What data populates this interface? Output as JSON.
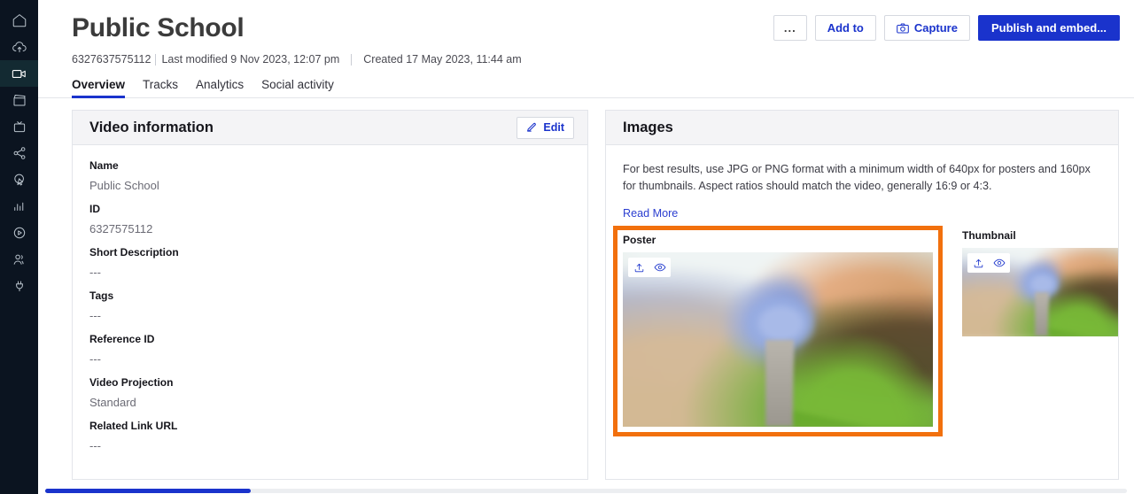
{
  "sidebar": {
    "items": [
      {
        "name": "home",
        "icon": "home-icon",
        "active": false
      },
      {
        "name": "upload",
        "icon": "cloud-upload-icon",
        "active": false
      },
      {
        "name": "video",
        "icon": "video-camera-icon",
        "active": true
      },
      {
        "name": "library",
        "icon": "clapperboard-icon",
        "active": false
      },
      {
        "name": "live",
        "icon": "tv-icon",
        "active": false
      },
      {
        "name": "social",
        "icon": "share-nodes-icon",
        "active": false
      },
      {
        "name": "interactivity",
        "icon": "cursor-target-icon",
        "active": false
      },
      {
        "name": "analytics",
        "icon": "bar-chart-icon",
        "active": false
      },
      {
        "name": "players",
        "icon": "play-circle-icon",
        "active": false
      },
      {
        "name": "audience",
        "icon": "users-icon",
        "active": false
      },
      {
        "name": "integrations",
        "icon": "plug-icon",
        "active": false
      }
    ]
  },
  "header": {
    "title": "Public School",
    "video_id": "6327637575112",
    "last_modified": "Last modified 9 Nov 2023, 12:07 pm",
    "created": "Created 17 May 2023, 11:44 am"
  },
  "actions": {
    "more_label": "...",
    "add_to_label": "Add to",
    "capture_label": "Capture",
    "publish_label": "Publish and embed...",
    "primary_color": "#1a33cc"
  },
  "tabs": [
    {
      "label": "Overview",
      "active": true
    },
    {
      "label": "Tracks",
      "active": false
    },
    {
      "label": "Analytics",
      "active": false
    },
    {
      "label": "Social activity",
      "active": false
    }
  ],
  "video_information": {
    "panel_title": "Video information",
    "edit_label": "Edit",
    "fields": [
      {
        "label": "Name",
        "value": "Public School"
      },
      {
        "label": "ID",
        "value": "6327575112"
      },
      {
        "label": "Short Description",
        "value": "---"
      },
      {
        "label": "Tags",
        "value": "---"
      },
      {
        "label": "Reference ID",
        "value": "---"
      },
      {
        "label": "Video Projection",
        "value": "Standard"
      },
      {
        "label": "Related Link URL",
        "value": "---"
      }
    ]
  },
  "images": {
    "panel_title": "Images",
    "description": "For best results, use JPG or PNG format with a minimum width of 640px for posters and 160px for thumbnails. Aspect ratios should match the video, generally 16:9 or 4:3.",
    "read_more_label": "Read More",
    "highlight_color": "#f2700d",
    "cards": [
      {
        "label": "Poster",
        "highlighted": true,
        "upload_icon": "upload-icon",
        "preview_icon": "eye-icon"
      },
      {
        "label": "Thumbnail",
        "highlighted": false,
        "upload_icon": "upload-icon",
        "preview_icon": "eye-icon"
      }
    ]
  }
}
